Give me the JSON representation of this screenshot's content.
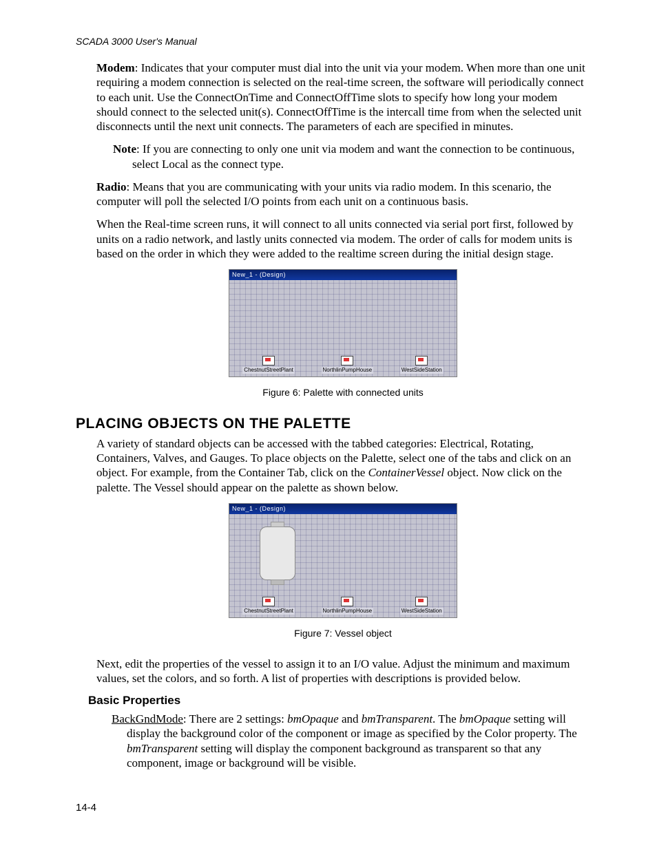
{
  "header": {
    "title": "SCADA 3000 User's Manual"
  },
  "paragraphs": {
    "modem_label": "Modem",
    "modem_text": ": Indicates that your computer must dial into the unit via your modem.  When more than one unit requiring a modem connection is selected on the real-time screen, the software will periodically connect to each unit.  Use the ConnectOnTime and ConnectOffTime slots to specify how long your modem should connect to the selected unit(s).  ConnectOffTime is the intercall time from when the selected unit disconnects until the next unit connects. The parameters of each are specified in minutes.",
    "note_label": "Note",
    "note_text": ": If you are connecting to only one unit via modem and want the connection to be continuous, select Local as the connect type.",
    "radio_label": "Radio",
    "radio_text": ": Means that you are communicating with your units via radio modem.  In this scenario, the computer will poll the selected I/O points from each unit on a continuous basis.",
    "realtime_text": "When the Real-time screen runs, it will connect to all units connected via serial port first, followed by units on a radio network, and lastly units connected via modem. The order of calls for modem units is based on the order in which they were added to the realtime screen during the initial design stage.",
    "placing_heading": "PLACING OBJECTS ON THE PALETTE",
    "placing_text_a": "A variety of standard objects can be accessed with the tabbed categories: Electrical, Rotating, Containers, Valves, and Gauges.  To place objects on the Palette, select one of the tabs and click on an object.  For example, from the Container Tab, click on the ",
    "placing_emph": "ContainerVessel",
    "placing_text_b": " object. Now click on the palette.  The Vessel should appear on the palette as shown below.",
    "next_text": "Next, edit the properties of the vessel to assign it to an I/O value.  Adjust the minimum and maximum values, set the colors, and so forth.  A list of properties with descriptions is provided below.",
    "basic_heading": "Basic Properties",
    "prop_name": "BackGndMode",
    "prop_a": ": There are 2 settings: ",
    "prop_em1": "bmOpaque",
    "prop_b": " and ",
    "prop_em2": "bmTransparent",
    "prop_c": ". The ",
    "prop_em3": "bmOpaque",
    "prop_d": " setting will display the background color of the component or image as specified by the Color property. The ",
    "prop_em4": "bmTransparent",
    "prop_e": " setting will display the component background as transparent so that any component, image or background will be visible."
  },
  "figures": {
    "fig6": {
      "window_title": "New_1 - (Design)",
      "caption": "Figure 6: Palette with connected units",
      "units": [
        "ChestnutStreetPlant",
        "NorthlinPumpHouse",
        "WestSideStation"
      ]
    },
    "fig7": {
      "window_title": "New_1 - (Design)",
      "caption": "Figure 7: Vessel object",
      "units": [
        "ChestnutStreetPlant",
        "NorthlinPumpHouse",
        "WestSideStation"
      ]
    }
  },
  "footer": {
    "page_number": "14-4"
  }
}
